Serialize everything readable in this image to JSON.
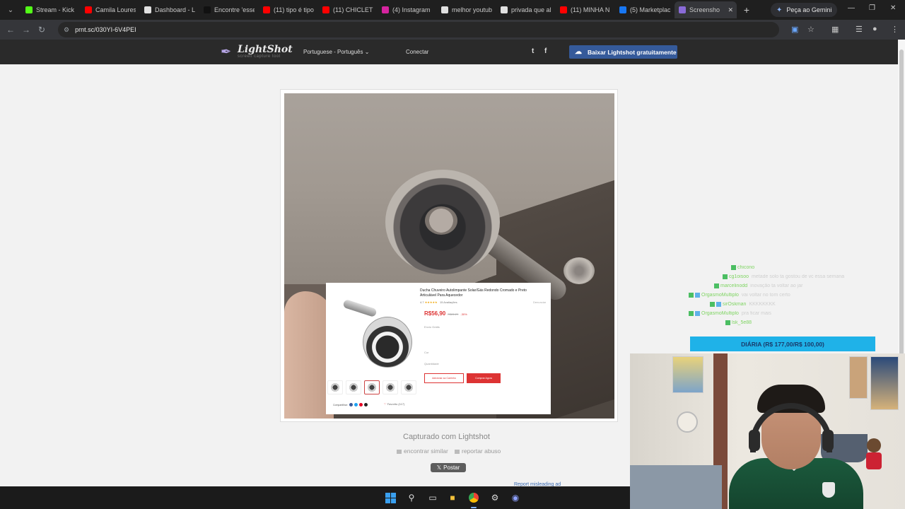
{
  "browser": {
    "tabs": [
      {
        "title": "Stream - Kick",
        "color": "#53fc18"
      },
      {
        "title": "Camila Loures",
        "color": "#ff0000"
      },
      {
        "title": "Dashboard - L",
        "color": "#e0e0e0"
      },
      {
        "title": "Encontre 'esse",
        "color": "#111111"
      },
      {
        "title": "(11) tipo é tipo",
        "color": "#ff0000"
      },
      {
        "title": "(11) CHICLETE",
        "color": "#ff0000"
      },
      {
        "title": "(4) Instagram",
        "color": "#d6249f"
      },
      {
        "title": "melhor youtub",
        "color": "#e0e0e0"
      },
      {
        "title": "privada que al",
        "color": "#e0e0e0"
      },
      {
        "title": "(11) MINHA N",
        "color": "#ff0000"
      },
      {
        "title": "(5) Marketplac",
        "color": "#1877f2"
      },
      {
        "title": "Screensho",
        "color": "#8a6bd8"
      }
    ],
    "gemini_label": "Peça ao Gemini",
    "url": "prnt.sc/030YI-6V4PEI"
  },
  "lightshot": {
    "logo_title": "LightShot",
    "logo_subtitle": "screen capture tool",
    "language": "Portuguese - Português",
    "connect": "Conectar",
    "twitter": "t",
    "facebook": "f",
    "download": "Baixar Lightshot gratuitamente",
    "captured_with": "Capturado com Lightshot",
    "find_similar": "encontrar similar",
    "report_abuse": "reportar abuso",
    "post": "Postar",
    "report_misleading": "Report misleading ad"
  },
  "product": {
    "title": "Ducha Chuveiro Autolimpante Solar/Gás Redondo Cromado e Preto Articulável Para Aquecedor",
    "rating": "4.7",
    "reviews": "15 Avaliações",
    "report": "Denunciar",
    "price": "R$56,90",
    "old_price": "R$81,29",
    "discount": "-30%",
    "shipping_label": "Envio Grátis",
    "color_label": "Cor",
    "quantity_label": "Quantidade",
    "add_to_cart": "Adicionar ao Carrinho",
    "buy_now": "Comprar Agora",
    "share_label": "Compartilhar:",
    "favorite": "Favorito (117)"
  },
  "stream": {
    "chat": [
      {
        "user": "chicono",
        "msg": ""
      },
      {
        "user": "cg1oisoo",
        "msg": "metade solo ta gostou de vc essa semana"
      },
      {
        "user": "marcelinodd",
        "msg": "inovação ta voltar ao jar"
      },
      {
        "user": "OrgasmoMultiplo",
        "msg": "vai voltar no tom certo"
      },
      {
        "user": "sirOskman",
        "msg": "KKKKKKKK"
      },
      {
        "user": "OrgasmoMultiplo",
        "msg": "pra ficar mais"
      },
      {
        "user": "lsk_5e88",
        "msg": ""
      }
    ],
    "diaria": "DIÁRIA (R$ 177,00/R$ 100,00)"
  }
}
